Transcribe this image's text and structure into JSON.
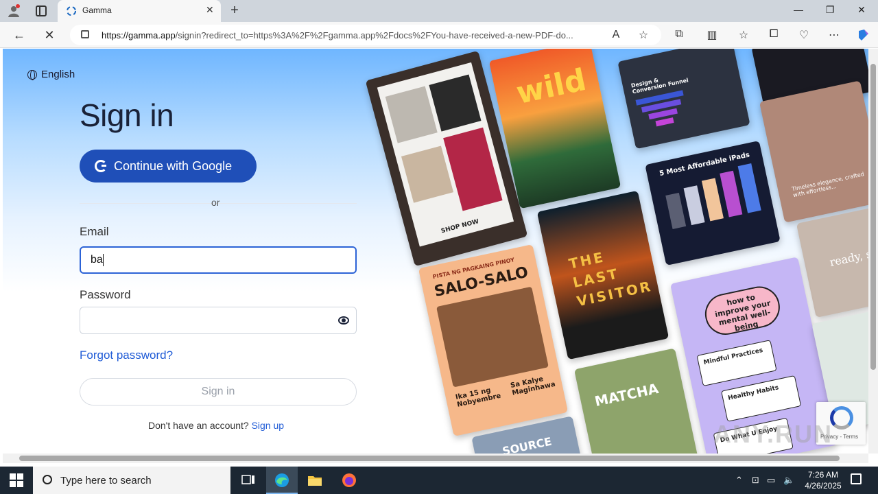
{
  "browser": {
    "tab_title": "Gamma",
    "url_host": "https://gamma.app",
    "url_rest": "/signin?redirect_to=https%3A%2F%2Fgamma.app%2Fdocs%2FYou-have-received-a-new-PDF-do..."
  },
  "page": {
    "language": "English",
    "title": "Sign in",
    "google_button": "Continue with Google",
    "separator": "or",
    "email_label": "Email",
    "email_value": "ba",
    "password_label": "Password",
    "forgot_password": "Forgot password?",
    "signin_button": "Sign in",
    "no_account": "Don't have an account?",
    "signup_link": "Sign up"
  },
  "collage": {
    "wild": "wild",
    "funnel_title": "Design & Conversion Funnel",
    "ipads_title": "5 Most Affordable iPads",
    "shop_now": "SHOP NOW",
    "salo_header": "PISTA NG PAGKAING PINOY",
    "salo_title": "SALO-SALO",
    "salo_date": "Ika 15 ng Nobyembre",
    "salo_place": "Sa Kalye Maginhawa",
    "last_visitor": "THE LAST VISITOR",
    "mental_title": "how to improve your mental well-being",
    "mental_1": "Mindful Practices",
    "mental_2": "Healthy Habits",
    "mental_3": "Do What U Enjoy",
    "matcha": "MATCHA",
    "source": "SOURCE",
    "ready": "ready, set",
    "elegance": "Timeless elegance, crafted with effortless..."
  },
  "recaptcha": {
    "text": "Privacy - Terms"
  },
  "watermark": "ANY.RUN",
  "taskbar": {
    "search_placeholder": "Type here to search",
    "time": "7:26 AM",
    "date": "4/26/2025"
  },
  "colors": {
    "primary": "#1f4fb8",
    "link": "#1f5bd6",
    "focus": "#2b62d6"
  }
}
